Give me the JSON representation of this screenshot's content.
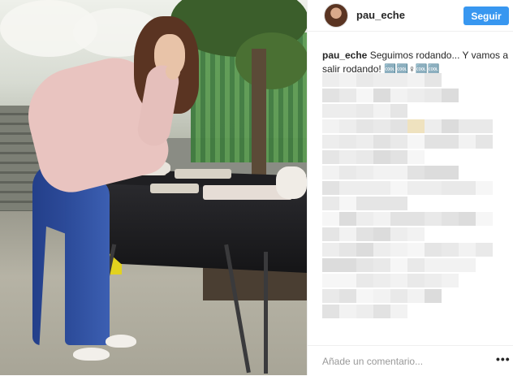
{
  "post": {
    "username": "pau_eche",
    "follow_label": "Seguir",
    "caption_username": "pau_eche",
    "caption_text": "Seguimos rodando... Y vamos a salir rodando! 🆒🆒♀🆒🆒",
    "comment_placeholder": "Añade un comentario...",
    "more_label": "•••"
  },
  "colors": {
    "follow_button": "#3897f0",
    "text": "#262626",
    "placeholder": "#999999",
    "divider": "#efefef"
  },
  "icons": {
    "avatar": "profile-photo",
    "more": "more-options-icon"
  }
}
